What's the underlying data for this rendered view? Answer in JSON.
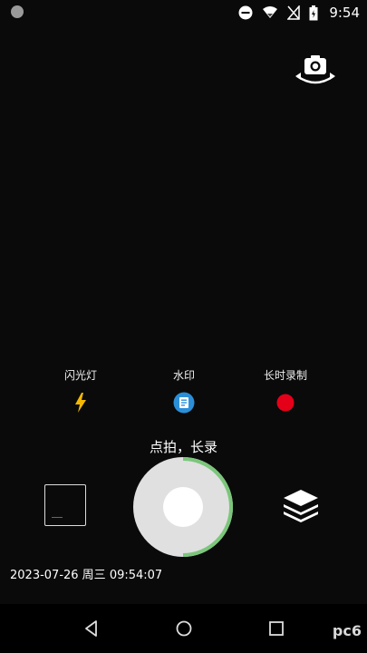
{
  "status_bar": {
    "time": "9:54",
    "icons": [
      "notification-dot-icon",
      "do-not-disturb-icon",
      "wifi-icon",
      "no-signal-icon",
      "battery-icon"
    ]
  },
  "camera": {
    "switch_icon": "camera-switch-icon",
    "options": [
      {
        "label": "闪光灯",
        "icon": "flash-icon"
      },
      {
        "label": "水印",
        "icon": "watermark-icon"
      },
      {
        "label": "长时录制",
        "icon": "record-dot-icon"
      }
    ],
    "hint": "点拍，长录",
    "timestamp": "2023-07-26 周三 09:54:07",
    "shutter_progress": 0.5,
    "layers_icon": "layers-icon",
    "gallery_icon": "gallery-thumbnail"
  },
  "nav": {
    "icons": [
      "back-icon",
      "home-icon",
      "recent-apps-icon"
    ],
    "logo_text": "pc6"
  },
  "colors": {
    "background": "#0a0a0a",
    "flash": "#f5b800",
    "watermark": "#2b8fd8",
    "record": "#e5001a",
    "shutter_ring": "#7bc67b",
    "shutter_bg": "#e0e0e0"
  }
}
